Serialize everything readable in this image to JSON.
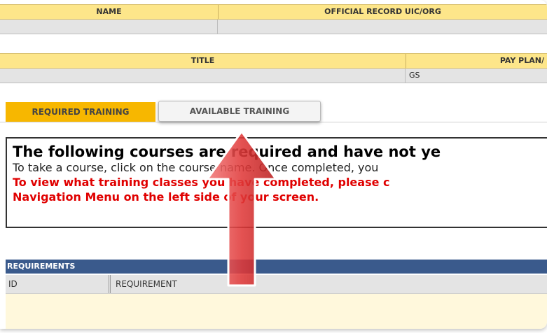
{
  "header": {
    "name_label": "NAME",
    "org_label": "OFFICIAL RECORD UIC/ORG",
    "title_label": "TITLE",
    "payplan_label": "PAY PLAN/",
    "payplan_value": "GS"
  },
  "tabs": {
    "required": "REQUIRED TRAINING",
    "available": "AVAILABLE TRAINING"
  },
  "notice": {
    "heading": "The following courses are required and have not ye",
    "body": "To take a course, click on the course name. Once completed, you",
    "red_line1": "To view what training classes you have completed, please c",
    "red_line2": "Navigation Menu on the left side of your screen."
  },
  "requirements": {
    "title": "REQUIREMENTS",
    "columns": [
      "ID",
      "REQUIREMENT"
    ]
  },
  "colors": {
    "header_bg": "#fde68a",
    "active_tab": "#f7b700",
    "req_bar": "#3a5a8c",
    "alert_red": "#e00000",
    "arrow": "#e03030"
  }
}
